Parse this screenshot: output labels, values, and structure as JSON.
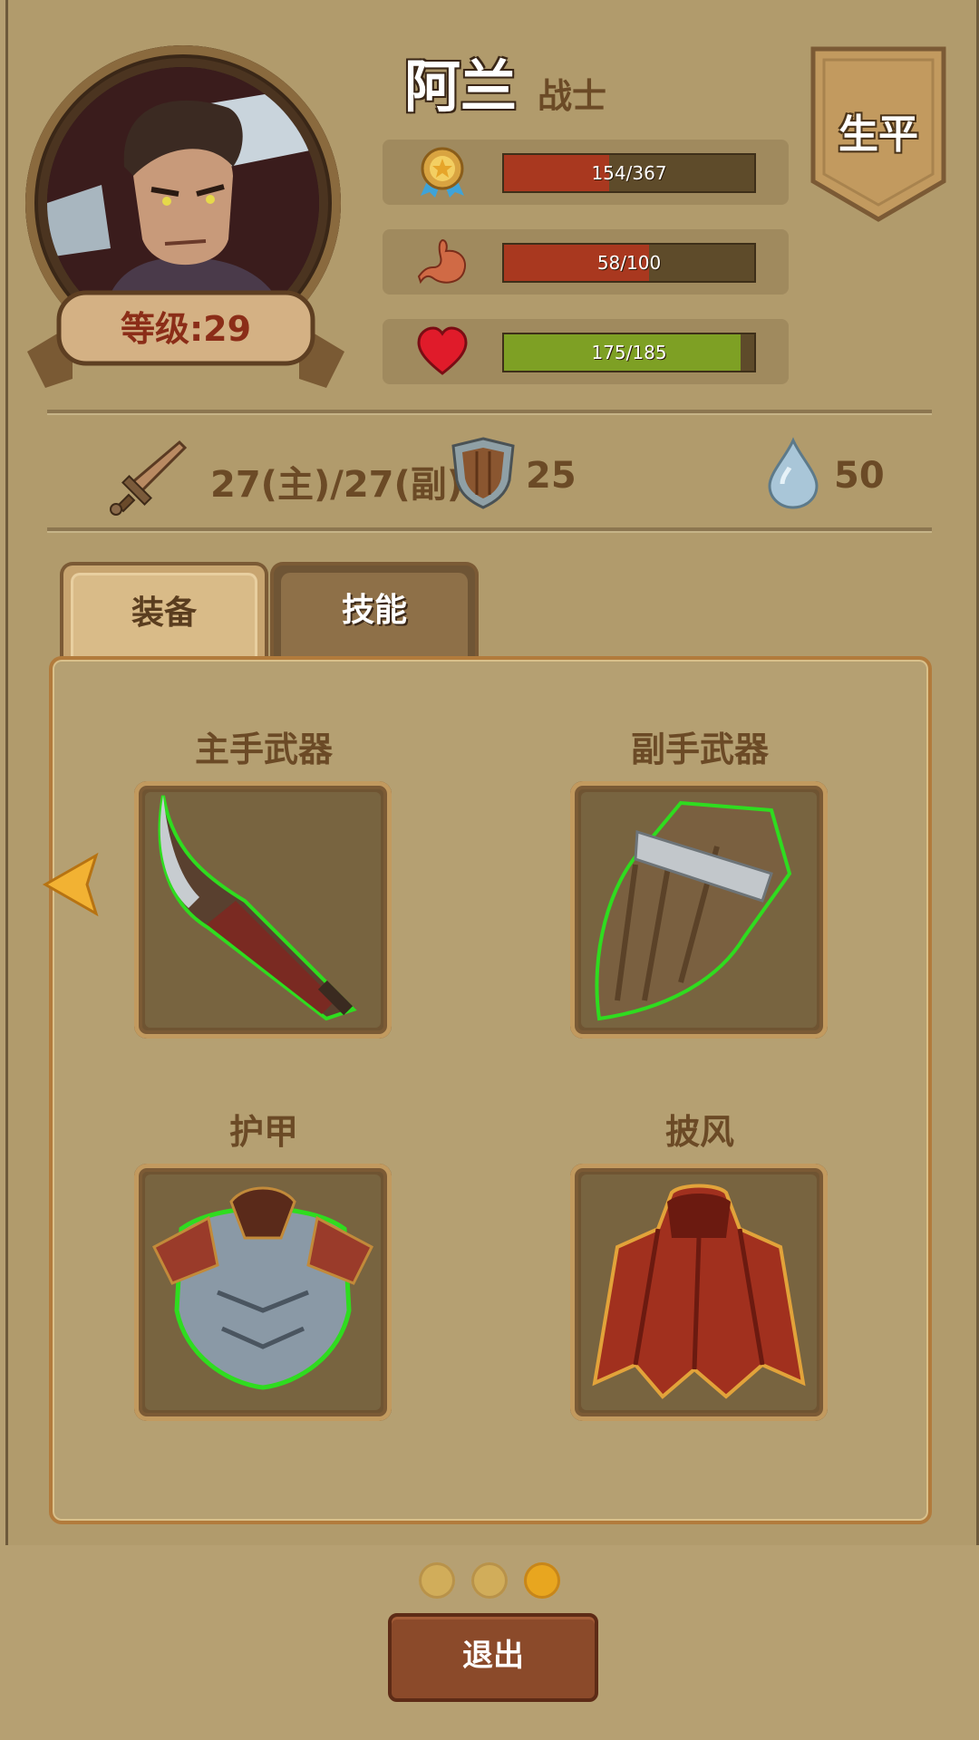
{
  "hero": {
    "name": "阿兰",
    "class": "战士",
    "level_label": "等级:29"
  },
  "career_button": "生平",
  "bars": [
    {
      "icon": "medal-icon",
      "text": "154/367",
      "value": 154,
      "max": 367,
      "color": "#a9381f"
    },
    {
      "icon": "stomach-icon",
      "text": "58/100",
      "value": 58,
      "max": 100,
      "color": "#a9381f"
    },
    {
      "icon": "heart-icon",
      "text": "175/185",
      "value": 175,
      "max": 185,
      "color": "#7ea024"
    }
  ],
  "stats": {
    "attack": "27(主)/27(副)",
    "defense": "25",
    "water": "50"
  },
  "tabs": [
    {
      "label": "装备",
      "active": true
    },
    {
      "label": "技能",
      "active": false
    }
  ],
  "slots": [
    {
      "label": "主手武器",
      "icon": "blade-icon"
    },
    {
      "label": "副手武器",
      "icon": "wooden-shield-icon"
    },
    {
      "label": "护甲",
      "icon": "chest-armor-icon"
    },
    {
      "label": "披风",
      "icon": "cloak-icon"
    }
  ],
  "pagination": {
    "count": 3,
    "active_index": 2
  },
  "exit_button": "退出",
  "colors": {
    "background": "#b19b6c",
    "accent": "#e8a61f",
    "exit": "#8b4a2a"
  }
}
